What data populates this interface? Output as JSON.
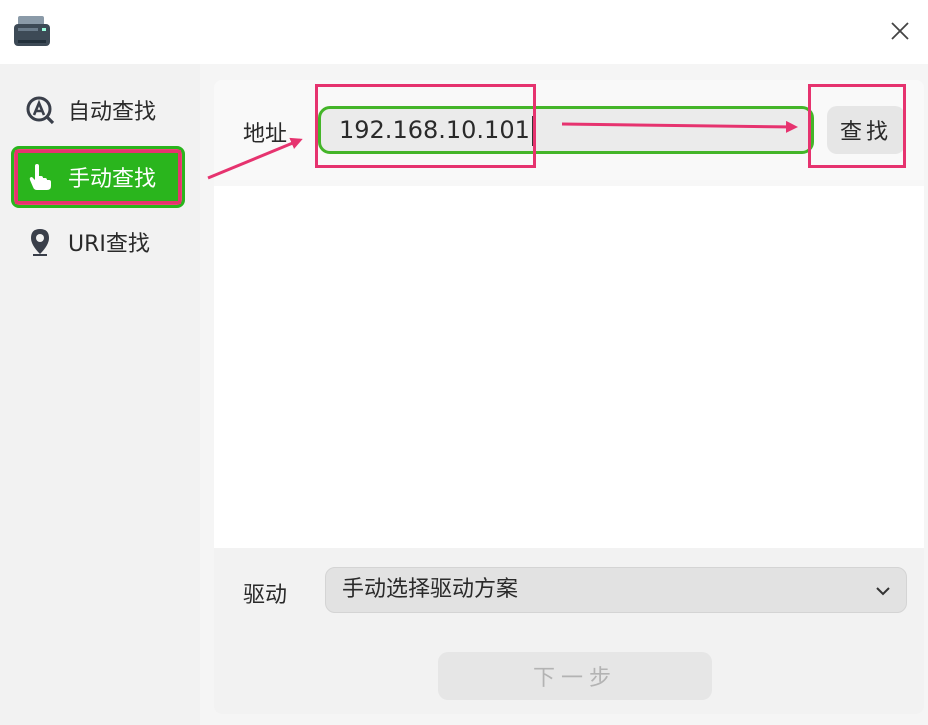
{
  "window": {
    "close_symbol": "✕",
    "app_icon": "printer-icon"
  },
  "sidebar": {
    "items": [
      {
        "label": "自动查找",
        "icon": "auto-search-icon",
        "active": false
      },
      {
        "label": "手动查找",
        "icon": "hand-pointer-icon",
        "active": true
      },
      {
        "label": "URI查找",
        "icon": "location-pin-icon",
        "active": false
      }
    ]
  },
  "address": {
    "label": "地址",
    "value": "192.168.10.101",
    "search_button": "查找"
  },
  "driver": {
    "label": "驱动",
    "selected": "手动选择驱动方案"
  },
  "footer": {
    "next_button": "下一步"
  },
  "colors": {
    "active_green": "#2ab51d",
    "input_border_green": "#44b529",
    "annotation_red": "#e6336f"
  }
}
